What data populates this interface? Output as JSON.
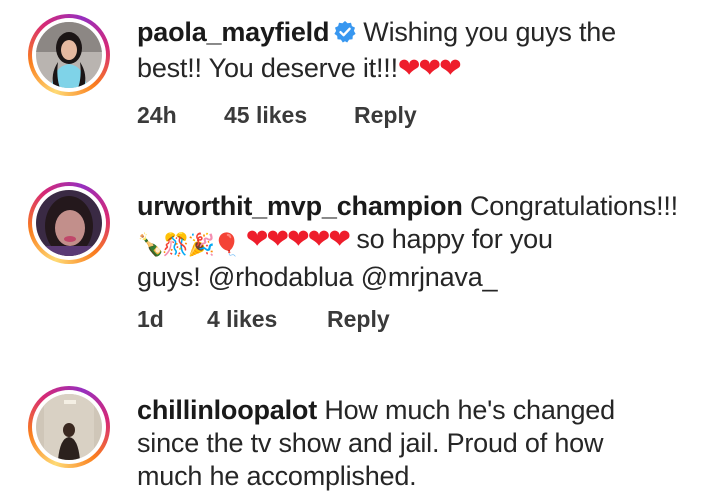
{
  "comments": [
    {
      "username": "paola_mayfield",
      "verified": true,
      "text_line1": "Wishing you guys the",
      "text_line2": "best!! You deserve it!!!",
      "hearts": "❤❤❤",
      "time": "24h",
      "likes": "45 likes",
      "reply": "Reply"
    },
    {
      "username": "urworthit_mvp_champion",
      "text_line1": "Congratulations!!!",
      "emoji_group": "🍾🎊🎉🎈",
      "hearts": "❤❤❤❤❤",
      "text_after_hearts": "so happy for you",
      "text_line3_prefix": "guys!",
      "mention1": "@rhodablua",
      "mention2": "@mrjnava_",
      "time": "1d",
      "likes": "4 likes",
      "reply": "Reply"
    },
    {
      "username": "chillinloopalot",
      "text_line1": "How much he's changed",
      "text_line2": "since the tv show and jail. Proud of how",
      "text_line3": "much he accomplished."
    }
  ],
  "colors": {
    "heart": "#ee1d2b",
    "verified_badge": "#3897f0",
    "text": "#262626"
  }
}
